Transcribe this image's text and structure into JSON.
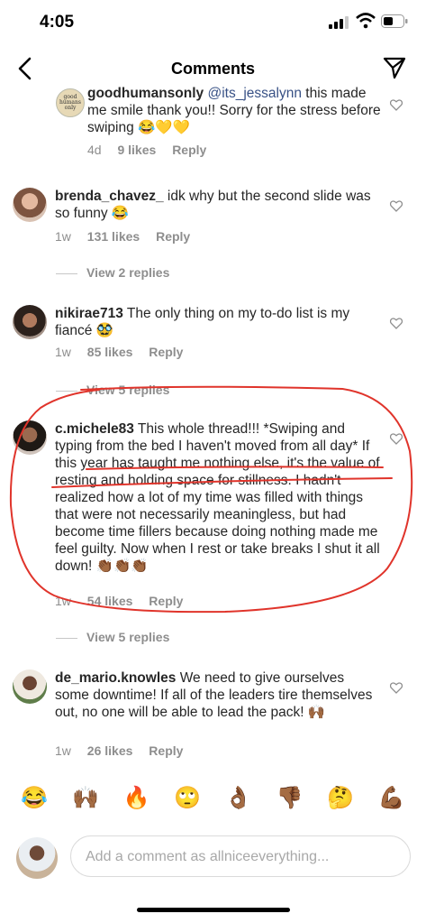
{
  "status": {
    "time": "4:05"
  },
  "nav": {
    "title": "Comments"
  },
  "comments": [
    {
      "user": "goodhumansonly",
      "mention": "@its_jessalynn",
      "text": " this made me smile thank you!! Sorry for the stress before swiping 😂💛💛",
      "age": "4d",
      "likes": "9 likes",
      "reply": "Reply",
      "avatar_text": "good humans only"
    },
    {
      "user": "brenda_chavez_",
      "text": " idk why but the second slide was so funny 😂",
      "age": "1w",
      "likes": "131 likes",
      "reply": "Reply",
      "view_replies": "View 2 replies"
    },
    {
      "user": "nikirae713",
      "text": " The only thing on my to-do list is my fiancé 🥸",
      "age": "1w",
      "likes": "85 likes",
      "reply": "Reply",
      "view_replies": "View 5 replies"
    },
    {
      "user": "c.michele83",
      "text": " This whole thread!!! *Swiping and typing from the bed I haven't moved from all day* If this year has taught me nothing else, it's the value of resting and holding space for stillness. I hadn't realized how a lot of my time was filled with things that were not necessarily meaningless, but had become time fillers because doing nothing made me feel guilty. Now when I rest or take breaks I shut it all down! 👏🏾👏🏾👏🏾",
      "age": "1w",
      "likes": "54 likes",
      "reply": "Reply",
      "view_replies": "View 5 replies"
    },
    {
      "user": "de_mario.knowles",
      "text": " We need to give ourselves some downtime! If all of the leaders tire themselves out, no one will be able to lead the pack! 🙌🏾",
      "age": "1w",
      "likes": "26 likes",
      "reply": "Reply"
    }
  ],
  "emoji_bar": [
    "😂",
    "🙌🏾",
    "🔥",
    "🙄",
    "👌🏾",
    "👎🏾",
    "🤔",
    "💪🏾"
  ],
  "composer": {
    "placeholder": "Add a comment as allniceeverything..."
  },
  "colors": {
    "annotation": "#e0342b",
    "mention": "#385185",
    "meta": "#8e8e8e"
  }
}
